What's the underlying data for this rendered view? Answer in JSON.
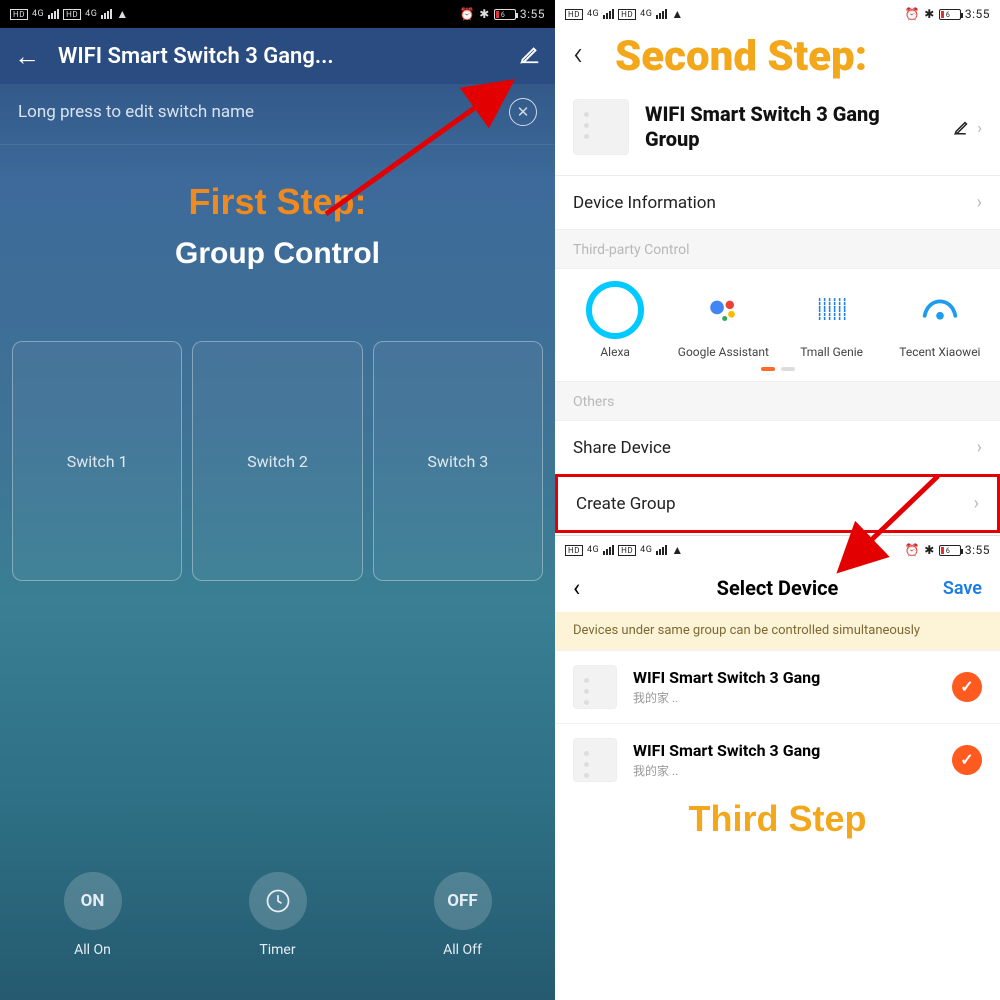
{
  "status": {
    "hd1": "HD",
    "hd2": "HD",
    "g": "4G",
    "wifi": "⋮",
    "alarm": "⏰",
    "bt": "✱",
    "batt": "6",
    "time": "3:55"
  },
  "left": {
    "title": "WIFI Smart Switch 3 Gang...",
    "editHint": "Long press to edit switch name",
    "stepLabel": "First Step:",
    "stepTitle": "Group Control",
    "switches": [
      "Switch 1",
      "Switch 2",
      "Switch 3"
    ],
    "bottom": {
      "on": "ON",
      "onLab": "All On",
      "timer": "⏱",
      "timerLab": "Timer",
      "off": "OFF",
      "offLab": "All Off"
    }
  },
  "right": {
    "stepLabel": "Second Step:",
    "deviceName": "WIFI Smart Switch 3 Gang Group",
    "rows": {
      "info": "Device Information",
      "share": "Share Device",
      "create": "Create Group"
    },
    "labels": {
      "third": "Third-party Control",
      "others": "Others"
    },
    "assistants": [
      {
        "name": "Alexa"
      },
      {
        "name": "Google Assistant"
      },
      {
        "name": "Tmall Genie"
      },
      {
        "name": "Tecent Xiaowei"
      }
    ]
  },
  "step3": {
    "title": "Select Device",
    "save": "Save",
    "banner": "Devices under same group can be controlled simultaneously",
    "devices": [
      {
        "title": "WIFI Smart Switch 3 Gang",
        "sub": "我的家 .."
      },
      {
        "title": "WIFI Smart Switch 3 Gang",
        "sub": "我的家 .."
      }
    ],
    "stepLabel": "Third Step"
  }
}
